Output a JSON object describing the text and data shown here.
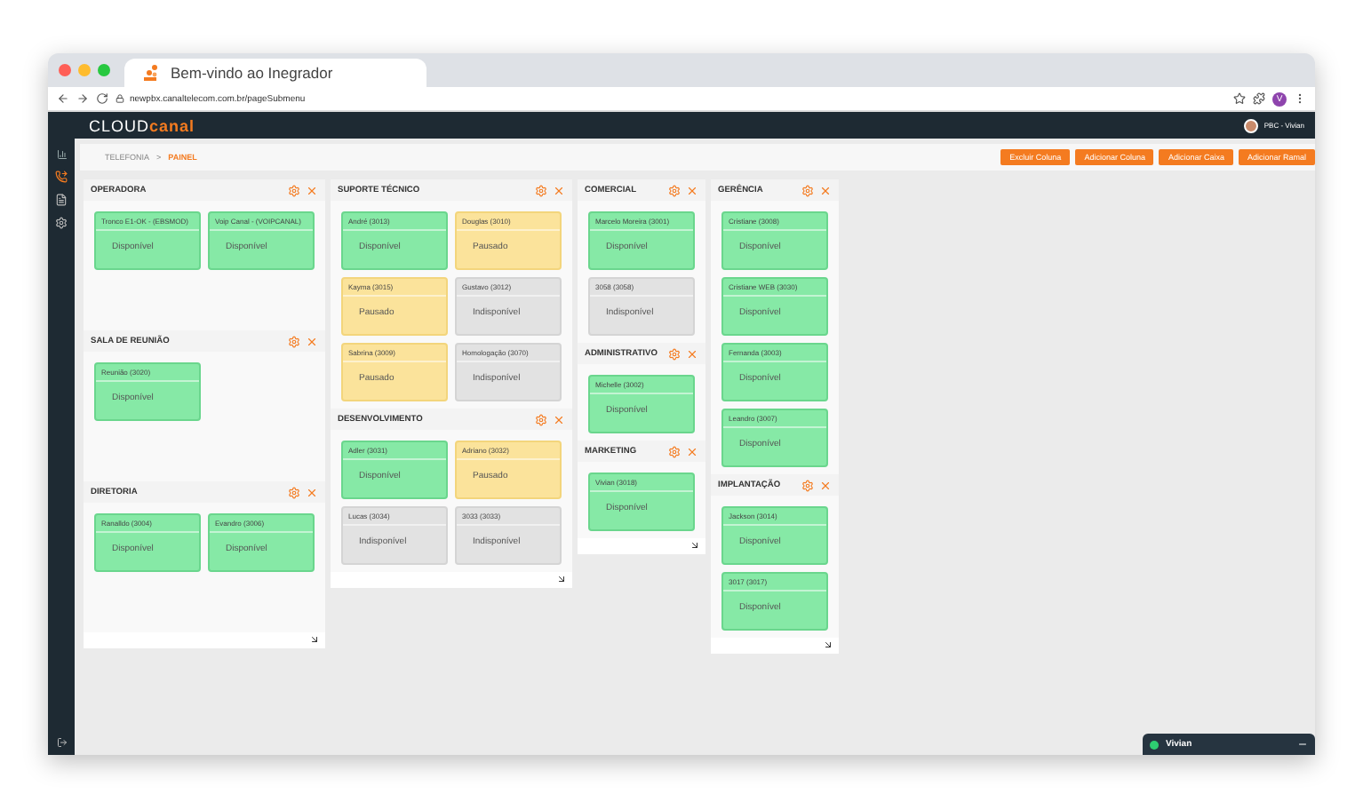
{
  "browser": {
    "tab_title": "Bem-vindo ao Inegrador",
    "url": "newpbx.canaltelecom.com.br/pageSubmenu",
    "profile": "V"
  },
  "header": {
    "logo_left": "CLOUD",
    "logo_right": "canal",
    "user": "PBC - Vivian"
  },
  "breadcrumb": {
    "parent": "TELEFONIA",
    "separator": ">",
    "current": "PAINEL"
  },
  "actions": [
    "Excluir Coluna",
    "Adicionar Coluna",
    "Adicionar Caixa",
    "Adicionar Ramal"
  ],
  "columns": [
    {
      "sections": [
        {
          "title": "OPERADORA",
          "cards": [
            {
              "name": "Tronco E1-OK - (EBSMOD)",
              "status": "Disponível",
              "kind": "available"
            },
            {
              "name": "Voip Canal - (VOIPCANAL)",
              "status": "Disponível",
              "kind": "available"
            }
          ]
        },
        {
          "title": "SALA DE REUNIÃO",
          "cards": [
            {
              "name": "Reunião (3020)",
              "status": "Disponível",
              "kind": "available"
            }
          ]
        },
        {
          "title": "DIRETORIA",
          "cards": [
            {
              "name": "Ranalldo (3004)",
              "status": "Disponível",
              "kind": "available"
            },
            {
              "name": "Evandro (3006)",
              "status": "Disponível",
              "kind": "available"
            }
          ]
        }
      ]
    },
    {
      "sections": [
        {
          "title": "SUPORTE TÉCNICO",
          "cards": [
            {
              "name": "André (3013)",
              "status": "Disponível",
              "kind": "available"
            },
            {
              "name": "Douglas (3010)",
              "status": "Pausado",
              "kind": "paused"
            },
            {
              "name": "Kayma (3015)",
              "status": "Pausado",
              "kind": "paused"
            },
            {
              "name": "Gustavo (3012)",
              "status": "Indisponível",
              "kind": "unavailable"
            },
            {
              "name": "Sabrina (3009)",
              "status": "Pausado",
              "kind": "paused"
            },
            {
              "name": "Homologação (3070)",
              "status": "Indisponível",
              "kind": "unavailable"
            }
          ]
        },
        {
          "title": "DESENVOLVIMENTO",
          "cards": [
            {
              "name": "Adler (3031)",
              "status": "Disponível",
              "kind": "available"
            },
            {
              "name": "Adriano (3032)",
              "status": "Pausado",
              "kind": "paused"
            },
            {
              "name": "Lucas (3034)",
              "status": "Indisponível",
              "kind": "unavailable"
            },
            {
              "name": "3033 (3033)",
              "status": "Indisponível",
              "kind": "unavailable"
            }
          ]
        }
      ]
    },
    {
      "sections": [
        {
          "title": "COMERCIAL",
          "cards": [
            {
              "name": "Marcelo Moreira (3001)",
              "status": "Disponível",
              "kind": "available"
            },
            {
              "name": "3058 (3058)",
              "status": "Indisponível",
              "kind": "unavailable"
            }
          ]
        },
        {
          "title": "ADMINISTRATIVO",
          "cards": [
            {
              "name": "Michelle (3002)",
              "status": "Disponível",
              "kind": "available"
            }
          ]
        },
        {
          "title": "MARKETING",
          "cards": [
            {
              "name": "Vivian (3018)",
              "status": "Disponível",
              "kind": "available"
            }
          ]
        }
      ]
    },
    {
      "sections": [
        {
          "title": "GERÊNCIA",
          "cards": [
            {
              "name": "Cristiane (3008)",
              "status": "Disponível",
              "kind": "available"
            },
            {
              "name": "Cristiane WEB (3030)",
              "status": "Disponível",
              "kind": "available"
            },
            {
              "name": "Fernanda (3003)",
              "status": "Disponível",
              "kind": "available"
            },
            {
              "name": "Leandro (3007)",
              "status": "Disponível",
              "kind": "available"
            }
          ]
        },
        {
          "title": "IMPLANTAÇÃO",
          "cards": [
            {
              "name": "Jackson (3014)",
              "status": "Disponível",
              "kind": "available"
            },
            {
              "name": "3017 (3017)",
              "status": "Disponível",
              "kind": "available"
            }
          ]
        }
      ]
    }
  ],
  "chat": {
    "name": "Vivian",
    "online": true
  }
}
